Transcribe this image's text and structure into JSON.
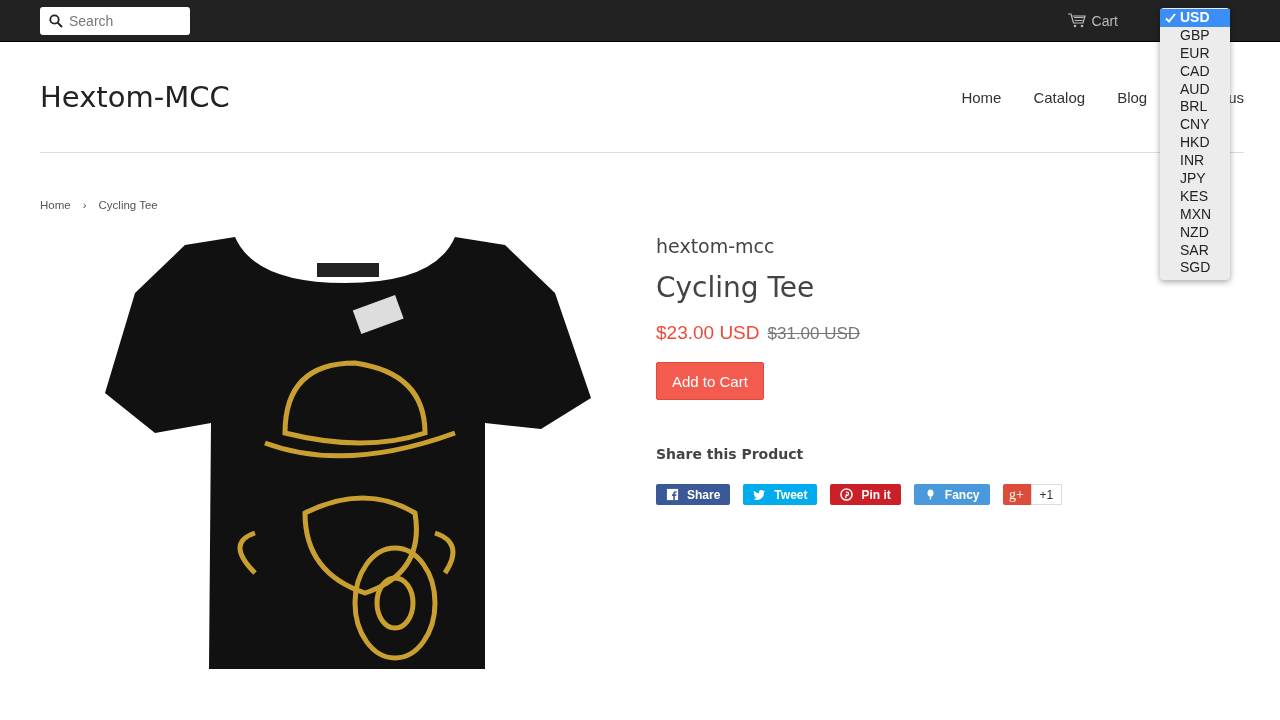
{
  "top_bar": {
    "search": {
      "placeholder": "Search"
    },
    "cart": {
      "label": "Cart"
    },
    "currency_menu": [
      {
        "code": "USD",
        "selected": true
      },
      {
        "code": "GBP",
        "selected": false
      },
      {
        "code": "EUR",
        "selected": false
      },
      {
        "code": "CAD",
        "selected": false
      },
      {
        "code": "AUD",
        "selected": false
      },
      {
        "code": "BRL",
        "selected": false
      },
      {
        "code": "CNY",
        "selected": false
      },
      {
        "code": "HKD",
        "selected": false
      },
      {
        "code": "INR",
        "selected": false
      },
      {
        "code": "JPY",
        "selected": false
      },
      {
        "code": "KES",
        "selected": false
      },
      {
        "code": "MXN",
        "selected": false
      },
      {
        "code": "NZD",
        "selected": false
      },
      {
        "code": "SAR",
        "selected": false
      },
      {
        "code": "SGD",
        "selected": false
      }
    ]
  },
  "header": {
    "logo": "Hextom-MCC",
    "nav": [
      "Home",
      "Catalog",
      "Blog",
      "us"
    ]
  },
  "breadcrumb": {
    "items": [
      "Home",
      "Cycling Tee"
    ],
    "separator": "›"
  },
  "product": {
    "vendor": "hextom-mcc",
    "title": "Cycling Tee",
    "price": "$23.00 USD",
    "compare_price": "$31.00 USD",
    "add_to_cart": "Add to Cart",
    "share_heading": "Share this Product",
    "share_buttons": [
      {
        "kind": "facebook",
        "label": "Share"
      },
      {
        "kind": "twitter",
        "label": "Tweet"
      },
      {
        "kind": "pinterest",
        "label": "Pin it"
      },
      {
        "kind": "fancy",
        "label": "Fancy"
      },
      {
        "kind": "google",
        "label": "g+",
        "count": "+1"
      }
    ]
  }
}
